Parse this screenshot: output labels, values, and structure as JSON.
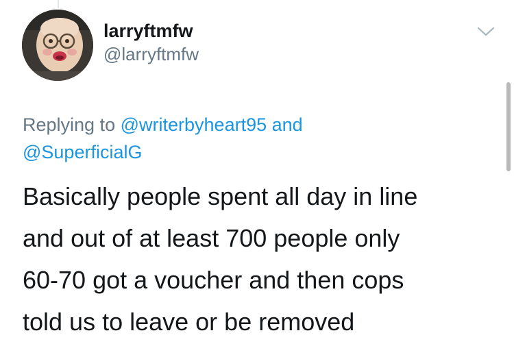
{
  "author": {
    "display_name": "larryftmfw",
    "handle": "@larryftmfw",
    "avatar_icon": "doll-face-avatar"
  },
  "menu": {
    "icon": "chevron-down-icon"
  },
  "reply": {
    "prefix": "Replying to",
    "mention_1": "@writerbyheart95",
    "conjunction": "and",
    "mention_2": "@SuperficialG"
  },
  "tweet": {
    "lines": [
      "Basically people spent all day in line",
      "and out of at least 700 people only",
      "60-70 got a voucher and then cops",
      "told us to leave or be removed"
    ]
  },
  "colors": {
    "link": "#1b95e0",
    "secondary_text": "#657786",
    "primary_text": "#14171a"
  }
}
